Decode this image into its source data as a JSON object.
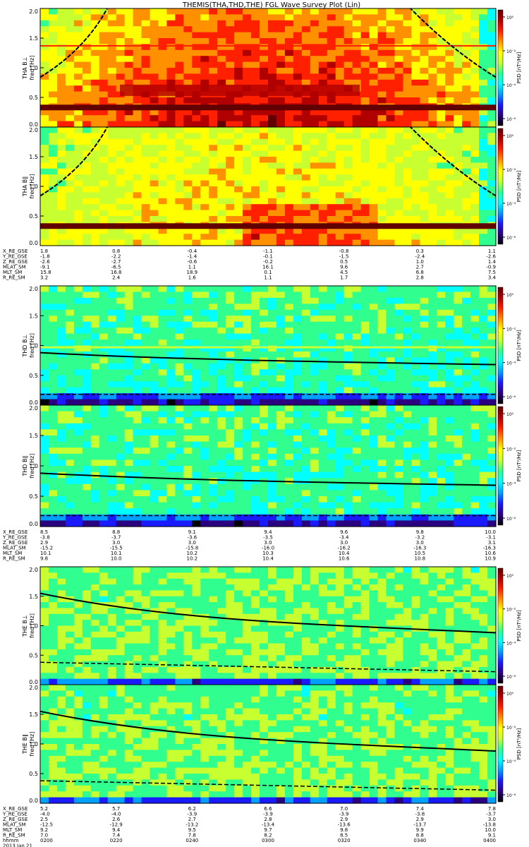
{
  "title": "THEMIS(THA,THD,THE) FGL Wave Survey Plot (Lin)",
  "cbar_label": "PSD [nT²/Hz]",
  "cbar_ticks": [
    "10⁰",
    "10⁻²",
    "10⁻⁴",
    "10⁻⁶"
  ],
  "colormap": [
    "#000000",
    "#2a0080",
    "#1a1aff",
    "#00a0ff",
    "#00ffff",
    "#30ff90",
    "#c8ff30",
    "#ffff00",
    "#ff9000",
    "#ff2000",
    "#b00000",
    "#600000"
  ],
  "chart_data": [
    {
      "type": "heatmap",
      "group": "THA",
      "panels": [
        {
          "ylabel": "THA B⊥",
          "yunit": "freq [Hz]",
          "intensity": "high"
        },
        {
          "ylabel": "THA B∥",
          "yunit": "freq [Hz]",
          "intensity": "medium"
        }
      ],
      "ylim": [
        0,
        2
      ],
      "yticks": [
        "0.0",
        "0.5",
        "1.0",
        "1.5",
        "2.0"
      ],
      "ephemeris": {
        "labels": [
          "X_RE_GSE",
          "Y_RE_GSE",
          "Z_RE_GSE",
          "MLAT_SM",
          "MLT_SM",
          "R_RE_SM"
        ],
        "columns": [
          [
            "1.8",
            "-1.8",
            "-2.6",
            "-9.1",
            "15.8",
            "3.2"
          ],
          [
            "0.8",
            "-2.2",
            "-2.7",
            "-6.5",
            "16.8",
            "2.4"
          ],
          [
            "-0.4",
            "-1.4",
            "-0.6",
            "1.1",
            "18.9",
            "1.6"
          ],
          [
            "-1.1",
            "-0.1",
            "-0.2",
            "16.1",
            "0.1",
            "1.1"
          ],
          [
            "-0.8",
            "-1.5",
            "0.5",
            "9.6",
            "4.5",
            "1.7"
          ],
          [
            "0.3",
            "-2.4",
            "1.0",
            "2.7",
            "6.8",
            "2.8"
          ],
          [
            "1.1",
            "-2.6",
            "1.4",
            "-0.9",
            "7.5",
            "3.4"
          ]
        ]
      }
    },
    {
      "type": "heatmap",
      "group": "THD",
      "panels": [
        {
          "ylabel": "THD B⊥",
          "yunit": "freq [Hz]",
          "intensity": "low"
        },
        {
          "ylabel": "THD B∥",
          "yunit": "freq [Hz]",
          "intensity": "low"
        }
      ],
      "ylim": [
        0,
        2
      ],
      "yticks": [
        "0.0",
        "0.5",
        "1.0",
        "1.5",
        "2.0"
      ],
      "ephemeris": {
        "labels": [
          "X_RE_GSE",
          "Y_RE_GSE",
          "Z_RE_GSE",
          "MLAT_SM",
          "MLT_SM",
          "R_RE_SM"
        ],
        "columns": [
          [
            "8.5",
            "-3.8",
            "2.9",
            "-15.2",
            "10.1",
            "9.8"
          ],
          [
            "8.8",
            "-3.7",
            "3.0",
            "-15.5",
            "10.1",
            "10.0"
          ],
          [
            "9.1",
            "-3.6",
            "3.0",
            "-15.8",
            "10.2",
            "10.2"
          ],
          [
            "9.4",
            "-3.5",
            "3.0",
            "-16.0",
            "10.3",
            "10.4"
          ],
          [
            "9.6",
            "-3.4",
            "3.0",
            "-16.2",
            "10.4",
            "10.6"
          ],
          [
            "9.8",
            "-3.2",
            "3.0",
            "-16.3",
            "10.5",
            "10.8"
          ],
          [
            "10.0",
            "-3.1",
            "3.1",
            "-16.3",
            "10.6",
            "10.9"
          ]
        ]
      }
    },
    {
      "type": "heatmap",
      "group": "THE",
      "panels": [
        {
          "ylabel": "THE B⊥",
          "yunit": "freq [Hz]",
          "intensity": "mid-low"
        },
        {
          "ylabel": "THE B∥",
          "yunit": "freq [Hz]",
          "intensity": "mid-low"
        }
      ],
      "ylim": [
        0,
        2
      ],
      "yticks": [
        "0.0",
        "0.5",
        "1.0",
        "1.5",
        "2.0"
      ],
      "ephemeris": {
        "labels": [
          "X_RE_GSE",
          "Y_RE_GSE",
          "Z_RE_GSE",
          "MLAT_SM",
          "MLT_SM",
          "R_RE_SM",
          "hhmm"
        ],
        "columns": [
          [
            "5.2",
            "-4.0",
            "2.5",
            "-12.5",
            "9.2",
            "7.0",
            "0200"
          ],
          [
            "5.7",
            "-4.0",
            "2.6",
            "-12.9",
            "9.4",
            "7.4",
            "0220"
          ],
          [
            "6.2",
            "-3.9",
            "2.7",
            "-13.2",
            "9.5",
            "7.8",
            "0240"
          ],
          [
            "6.6",
            "-3.9",
            "2.8",
            "-13.4",
            "9.7",
            "8.2",
            "0300"
          ],
          [
            "7.0",
            "-3.9",
            "2.9",
            "-13.6",
            "9.8",
            "8.5",
            "0320"
          ],
          [
            "7.4",
            "-3.8",
            "2.9",
            "-13.7",
            "9.9",
            "8.8",
            "0340"
          ],
          [
            "7.8",
            "-3.7",
            "3.0",
            "-13.8",
            "10.0",
            "9.1",
            "0400"
          ]
        ],
        "date": "2013 Jan 21"
      }
    }
  ]
}
